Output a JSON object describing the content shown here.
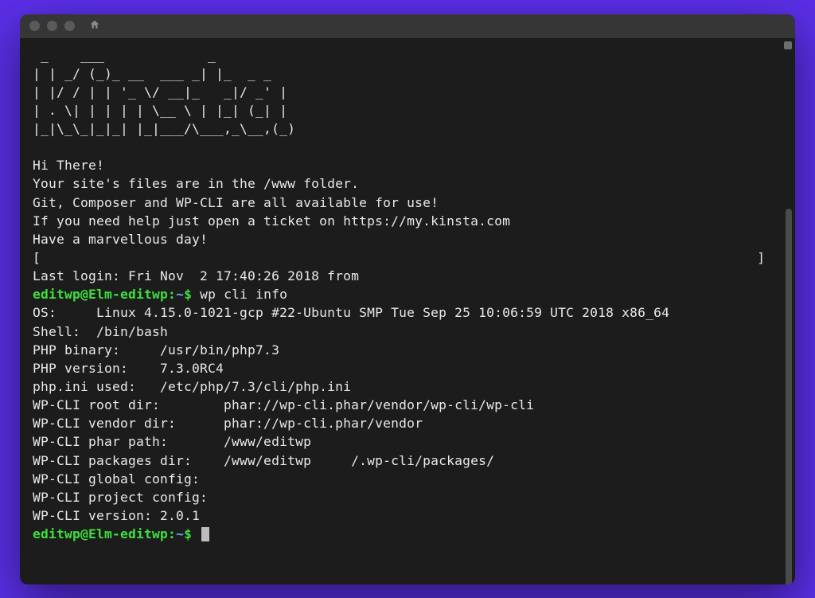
{
  "ascii_art": " _    ___             _\n| | _/ (_)_ __  ___ _| |_  _ _\n| |/ / | | '_ \\/ __|_   _|/ _' |\n| . \\| | | | | \\__ \\ | |_| (_| |\n|_|\\_\\_|_|_| |_|___/\\___,_\\__,(_)",
  "welcome": {
    "line1": "Hi There!",
    "line2": "Your site's files are in the /www folder.",
    "line3": "Git, Composer and WP-CLI are all available for use!",
    "line4": "If you need help just open a ticket on https://my.kinsta.com",
    "line5": "Have a marvellous day!"
  },
  "bracket_left": "[",
  "bracket_right": "]",
  "last_login": "Last login: Fri Nov  2 17:40:26 2018 from",
  "prompt": {
    "userhost": "editwp@Elm-editwp",
    "separator": ":",
    "path": "~",
    "dollar": "$"
  },
  "command1": "wp cli info",
  "output": {
    "os": "OS:     Linux 4.15.0-1021-gcp #22-Ubuntu SMP Tue Sep 25 10:06:59 UTC 2018 x86_64",
    "shell": "Shell:  /bin/bash",
    "php_binary": "PHP binary:     /usr/bin/php7.3",
    "php_version": "PHP version:    7.3.0RC4",
    "php_ini": "php.ini used:   /etc/php/7.3/cli/php.ini",
    "wpcli_root": "WP-CLI root dir:        phar://wp-cli.phar/vendor/wp-cli/wp-cli",
    "wpcli_vendor": "WP-CLI vendor dir:      phar://wp-cli.phar/vendor",
    "wpcli_phar": "WP-CLI phar path:       /www/editwp",
    "wpcli_packages": "WP-CLI packages dir:    /www/editwp     /.wp-cli/packages/",
    "wpcli_gconfig": "WP-CLI global config:",
    "wpcli_pconfig": "WP-CLI project config:",
    "wpcli_version": "WP-CLI version: 2.0.1"
  }
}
